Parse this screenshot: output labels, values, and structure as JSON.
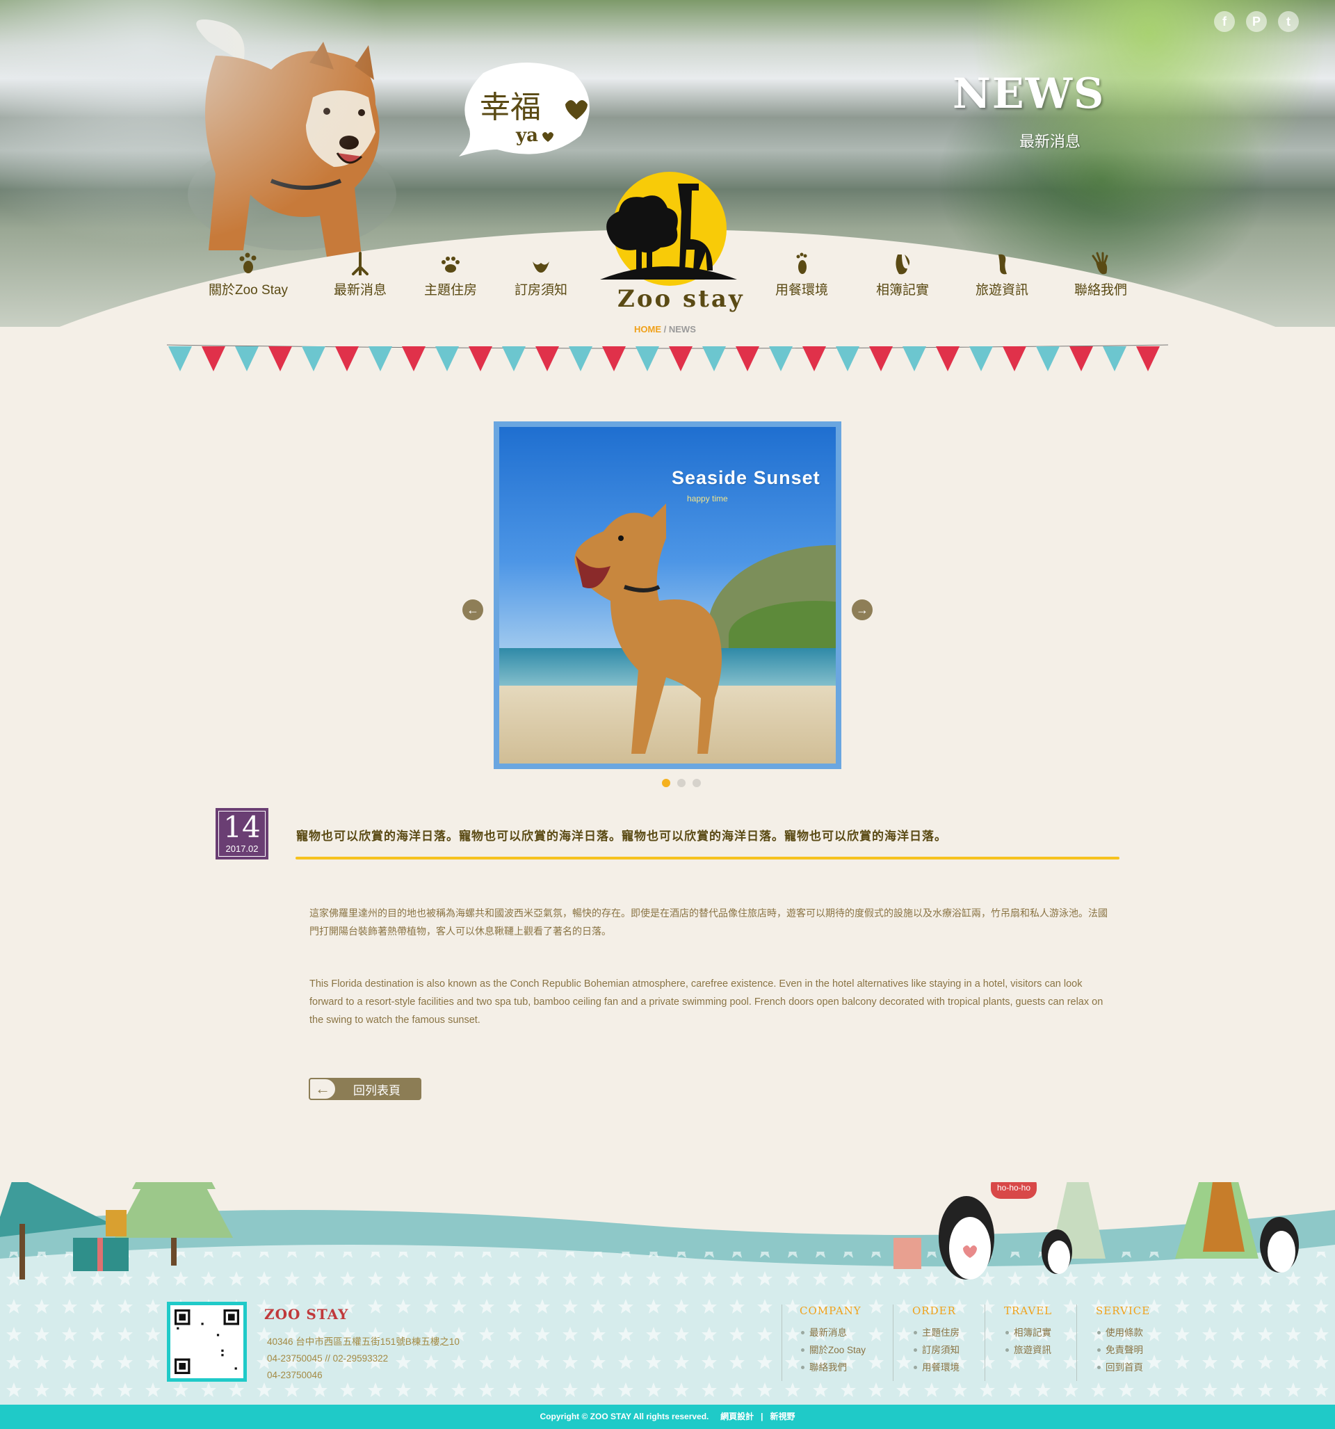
{
  "social": [
    "f",
    "P",
    "t"
  ],
  "bubble": {
    "line1": "幸福",
    "line2": "ya"
  },
  "hero": {
    "title": "NEWS",
    "subtitle": "最新消息"
  },
  "nav": {
    "left": [
      {
        "label": "關於Zoo Stay",
        "icon": "paw-icon"
      },
      {
        "label": "最新消息",
        "icon": "bird-foot-icon"
      },
      {
        "label": "主題住房",
        "icon": "cat-paw-icon"
      },
      {
        "label": "訂房須知",
        "icon": "hoof-icon"
      }
    ],
    "right": [
      {
        "label": "用餐環境",
        "icon": "foot-icon"
      },
      {
        "label": "相簿記實",
        "icon": "claw-icon"
      },
      {
        "label": "旅遊資訊",
        "icon": "footprint-icon"
      },
      {
        "label": "聯絡我們",
        "icon": "hand-icon"
      }
    ]
  },
  "logo": {
    "text": "Zoo  stay"
  },
  "breadcrumb": {
    "home": "HOME",
    "sep": "/",
    "current": "NEWS"
  },
  "slider": {
    "title": "Seaside  Sunset",
    "subtitle": "happy time",
    "dots": 3,
    "active": 0
  },
  "article": {
    "day": "14",
    "yearmonth": "2017.02",
    "title": "寵物也可以欣賞的海洋日落。寵物也可以欣賞的海洋日落。寵物也可以欣賞的海洋日落。寵物也可以欣賞的海洋日落。",
    "para_zh": "這家佛羅里達州的目的地也被稱為海螺共和國波西米亞氣氛，暢快的存在。即使是在酒店的替代品像住旅店時，遊客可以期待的度假式的設施以及水療浴缸兩，竹吊扇和私人游泳池。法國門打開陽台裝飾著熱帶植物，客人可以休息鞦韆上觀看了著名的日落。",
    "para_en": "This Florida destination is also known as the Conch Republic Bohemian atmosphere, carefree existence. Even in the hotel alternatives like staying in a hotel, visitors can look forward to a resort-style facilities and two spa tub, bamboo ceiling fan and a private swimming pool. French doors open balcony decorated with tropical plants, guests can relax on the swing to watch the famous sunset.",
    "back": "回列表頁"
  },
  "penguin_bubble": "ho-ho-ho",
  "footer": {
    "brand": "ZOO STAY",
    "address": "40346 台中市西區五權五街151號B棟五樓之10",
    "phone1": "04-23750045 // 02-29593322",
    "phone2": "04-23750046",
    "columns": [
      {
        "head": "COMPANY",
        "items": [
          "最新消息",
          "關於Zoo Stay",
          "聯絡我們"
        ]
      },
      {
        "head": "ORDER",
        "items": [
          "主題住房",
          "訂房須知",
          "用餐環境"
        ]
      },
      {
        "head": "TRAVEL",
        "items": [
          "相簿記實",
          "旅遊資訊"
        ]
      },
      {
        "head": "SERVICE",
        "items": [
          "使用條款",
          "免責聲明",
          "回到首頁"
        ]
      }
    ],
    "copyright": "Copyright © ZOO STAY All rights reserved.",
    "credit_label": "網頁設計",
    "credit_sep": "|",
    "credit_name": "新視野"
  },
  "colors": {
    "accent": "#f6c21f",
    "date_bg": "#6a3e73",
    "brand_red": "#c0393b",
    "teal": "#1fcac8",
    "text": "#5a4a14"
  }
}
